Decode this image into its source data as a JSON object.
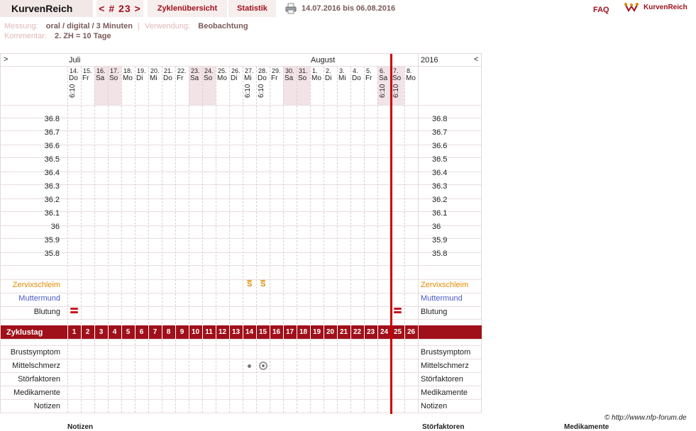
{
  "topbar": {
    "brand": "KurvenReich",
    "cycle": "< # 23 >",
    "overview": "Zyklenübersicht",
    "stats": "Statistik",
    "daterange": "14.07.2016 bis 06.08.2016",
    "faq": "FAQ",
    "logo_text": "KurvenReich"
  },
  "meta": {
    "measure_label": "Messung:",
    "measure_value": "oral / digital / 3 Minuten",
    "sep": "|",
    "use_label": "Verwendung:",
    "use_value": "Beobachtung",
    "comment_label": "Kommentar:",
    "comment_value": "2. ZH = 10 Tage"
  },
  "calendar": {
    "nav_left": ">",
    "nav_right": "<",
    "month1": "Juli",
    "month2": "August",
    "year": "2016",
    "days": [
      {
        "d": "14.",
        "w": "Do",
        "t": "6:10",
        "we": false
      },
      {
        "d": "15.",
        "w": "Fr",
        "t": "",
        "we": false
      },
      {
        "d": "16.",
        "w": "Sa",
        "t": "",
        "we": true
      },
      {
        "d": "17.",
        "w": "So",
        "t": "",
        "we": true
      },
      {
        "d": "18.",
        "w": "Mo",
        "t": "",
        "we": false
      },
      {
        "d": "19.",
        "w": "Di",
        "t": "",
        "we": false
      },
      {
        "d": "20.",
        "w": "Mi",
        "t": "",
        "we": false
      },
      {
        "d": "21.",
        "w": "Do",
        "t": "",
        "we": false
      },
      {
        "d": "22.",
        "w": "Fr",
        "t": "",
        "we": false
      },
      {
        "d": "23.",
        "w": "Sa",
        "t": "",
        "we": true
      },
      {
        "d": "24.",
        "w": "So",
        "t": "",
        "we": true
      },
      {
        "d": "25.",
        "w": "Mo",
        "t": "",
        "we": false
      },
      {
        "d": "26.",
        "w": "Di",
        "t": "",
        "we": false
      },
      {
        "d": "27.",
        "w": "Mi",
        "t": "6:10",
        "we": false
      },
      {
        "d": "28.",
        "w": "Do",
        "t": "6:10",
        "we": false
      },
      {
        "d": "29.",
        "w": "Fr",
        "t": "",
        "we": false
      },
      {
        "d": "30.",
        "w": "Sa",
        "t": "",
        "we": true
      },
      {
        "d": "31.",
        "w": "So",
        "t": "",
        "we": true
      },
      {
        "d": "1.",
        "w": "Mo",
        "t": "",
        "we": false
      },
      {
        "d": "2.",
        "w": "Di",
        "t": "",
        "we": false
      },
      {
        "d": "3.",
        "w": "Mi",
        "t": "",
        "we": false
      },
      {
        "d": "4.",
        "w": "Do",
        "t": "",
        "we": false
      },
      {
        "d": "5.",
        "w": "Fr",
        "t": "",
        "we": false
      },
      {
        "d": "6.",
        "w": "Sa",
        "t": "6:10",
        "we": true
      },
      {
        "d": "7.",
        "w": "So",
        "t": "6:10",
        "we": true
      },
      {
        "d": "8.",
        "w": "Mo",
        "t": "",
        "we": false
      }
    ],
    "temps": [
      "36.8",
      "36.7",
      "36.6",
      "36.5",
      "36.4",
      "36.3",
      "36.2",
      "36.1",
      "36",
      "35.9",
      "35.8"
    ],
    "rows": {
      "mucus": "Zervixschleim",
      "cervix": "Muttermund",
      "bleeding": "Blutung",
      "cycleday": "Zyklustag",
      "breast": "Brustsymptom",
      "midpain": "Mittelschmerz",
      "disturb": "Störfaktoren",
      "meds": "Medikamente",
      "notes": "Notizen"
    },
    "mucus_symbol": "S",
    "mucus_days": [
      14,
      15
    ],
    "bleeding_days": [
      1,
      25
    ],
    "midpain_dot_day": 14,
    "midpain_ring_day": 15,
    "cycleday_numbers": [
      "1",
      "2",
      "3",
      "4",
      "5",
      "6",
      "7",
      "8",
      "9",
      "10",
      "11",
      "12",
      "13",
      "14",
      "15",
      "16",
      "17",
      "18",
      "19",
      "20",
      "21",
      "22",
      "23",
      "24",
      "25",
      "26"
    ]
  },
  "footer": {
    "credit": "© http://www.nfp-forum.de",
    "notes": "Notizen",
    "disturb": "Störfaktoren",
    "meds": "Medikamente"
  },
  "colors": {
    "accent": "#a0101a",
    "mucus": "#e08a00",
    "cervix": "#4a5ac8",
    "weekend": "#f2e3e6",
    "grid": "#e6d7d7"
  }
}
